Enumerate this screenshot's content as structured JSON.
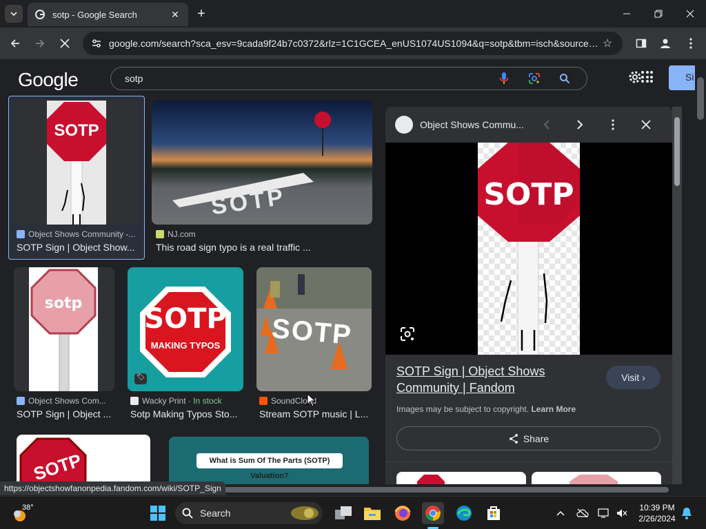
{
  "browser": {
    "tab_title": "sotp - Google Search",
    "url": "google.com/search?sca_esv=9cada9f24b7c0372&rlz=1C1GCEA_enUS1074US1094&q=sotp&tbm=isch&source=l...",
    "status_url": "https://objectshowfanonpedia.fandom.com/wiki/SOTP_Sign"
  },
  "google": {
    "logo": "Google",
    "query": "sotp",
    "signin_label": "Si"
  },
  "results": [
    {
      "source": "Object Shows Community -...",
      "caption": "SOTP Sign | Object Show...",
      "thumb_text": "SOTP"
    },
    {
      "source": "NJ.com",
      "caption": "This road sign typo is a real traffic ...",
      "thumb_text": "SOTP"
    },
    {
      "source": "Object Shows Com...",
      "caption": "SOTP Sign | Object ...",
      "thumb_text": "sotp"
    },
    {
      "source": "Wacky Print",
      "stock": "In stock",
      "caption": "Sotp Making Typos Sto...",
      "thumb_text": "SOTP",
      "thumb_sub": "MAKING TYPOS"
    },
    {
      "source": "SoundCloud",
      "caption": "Stream SOTP music | L...",
      "thumb_text": "SOTP"
    },
    {
      "source": "",
      "caption": "",
      "thumb_text": "SOTP"
    },
    {
      "source": "",
      "caption": "",
      "thumb_text": "What is Sum Of The Parts (SOTP) Valuation?"
    }
  ],
  "panel": {
    "source": "Object Shows Commu...",
    "image_text": "SOTP",
    "title": "SOTP Sign | Object Shows Community | Fandom",
    "visit_label": "Visit",
    "copyright": "Images may be subject to copyright.",
    "learn_more": "Learn More",
    "share_label": "Share"
  },
  "taskbar": {
    "temperature": "38°",
    "search_label": "Search",
    "time": "10:39 PM",
    "date": "2/26/2024"
  }
}
